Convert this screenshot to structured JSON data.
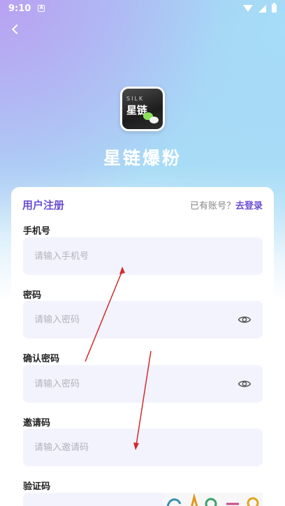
{
  "status_bar": {
    "time": "9:10"
  },
  "app": {
    "name": "星链爆粉",
    "logo_silk": "SILK",
    "logo_text": "星链"
  },
  "register": {
    "title": "用户注册",
    "login_prompt": "已有账号？",
    "login_link": "去登录"
  },
  "fields": {
    "phone": {
      "label": "手机号",
      "placeholder": "请输入手机号"
    },
    "password": {
      "label": "密码",
      "placeholder": "请输入密码"
    },
    "confirm_password": {
      "label": "确认密码",
      "placeholder": "请输入密码"
    },
    "invite_code": {
      "label": "邀请码",
      "placeholder": "请输入邀请码"
    },
    "captcha": {
      "label": "验证码"
    }
  },
  "colors": {
    "accent": "#6b4fd1",
    "input_bg": "#f2f3fd",
    "annotation_arrow": "#d12b2b"
  }
}
